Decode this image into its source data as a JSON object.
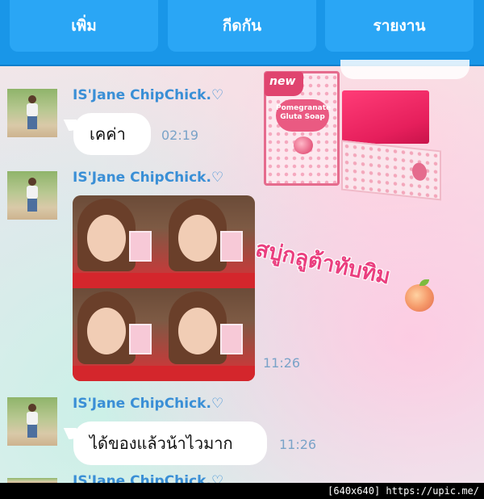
{
  "topbar": {
    "buttons": [
      {
        "label": "เพิ่ม"
      },
      {
        "label": "กีดกัน"
      },
      {
        "label": "รายงาน"
      }
    ]
  },
  "messages": [
    {
      "sender": "IS'Jane ChipChick.♡",
      "text": "เคค่า",
      "time": "02:19"
    },
    {
      "sender": "IS'Jane ChipChick.♡",
      "type": "photo",
      "time": "11:26"
    },
    {
      "sender": "IS'Jane ChipChick.♡",
      "text": "ได้ของแล้วน้าไวมาก",
      "time": "11:26"
    },
    {
      "sender": "IS'Jane ChipChick.♡"
    }
  ],
  "overlay": {
    "badge": "new",
    "product_label": "Pomegranate Gluta Soap",
    "caption": "สบู่กลูต้าทับทิม",
    "colors": {
      "pink": "#ea3f7f",
      "soap": "#e61f5c"
    }
  },
  "watermark": "[640x640] https://upic.me/",
  "colors": {
    "topbar": "#1996e8",
    "button": "#2aa6f5",
    "sender": "#3a8fd6",
    "time": "#7aa3c8"
  }
}
